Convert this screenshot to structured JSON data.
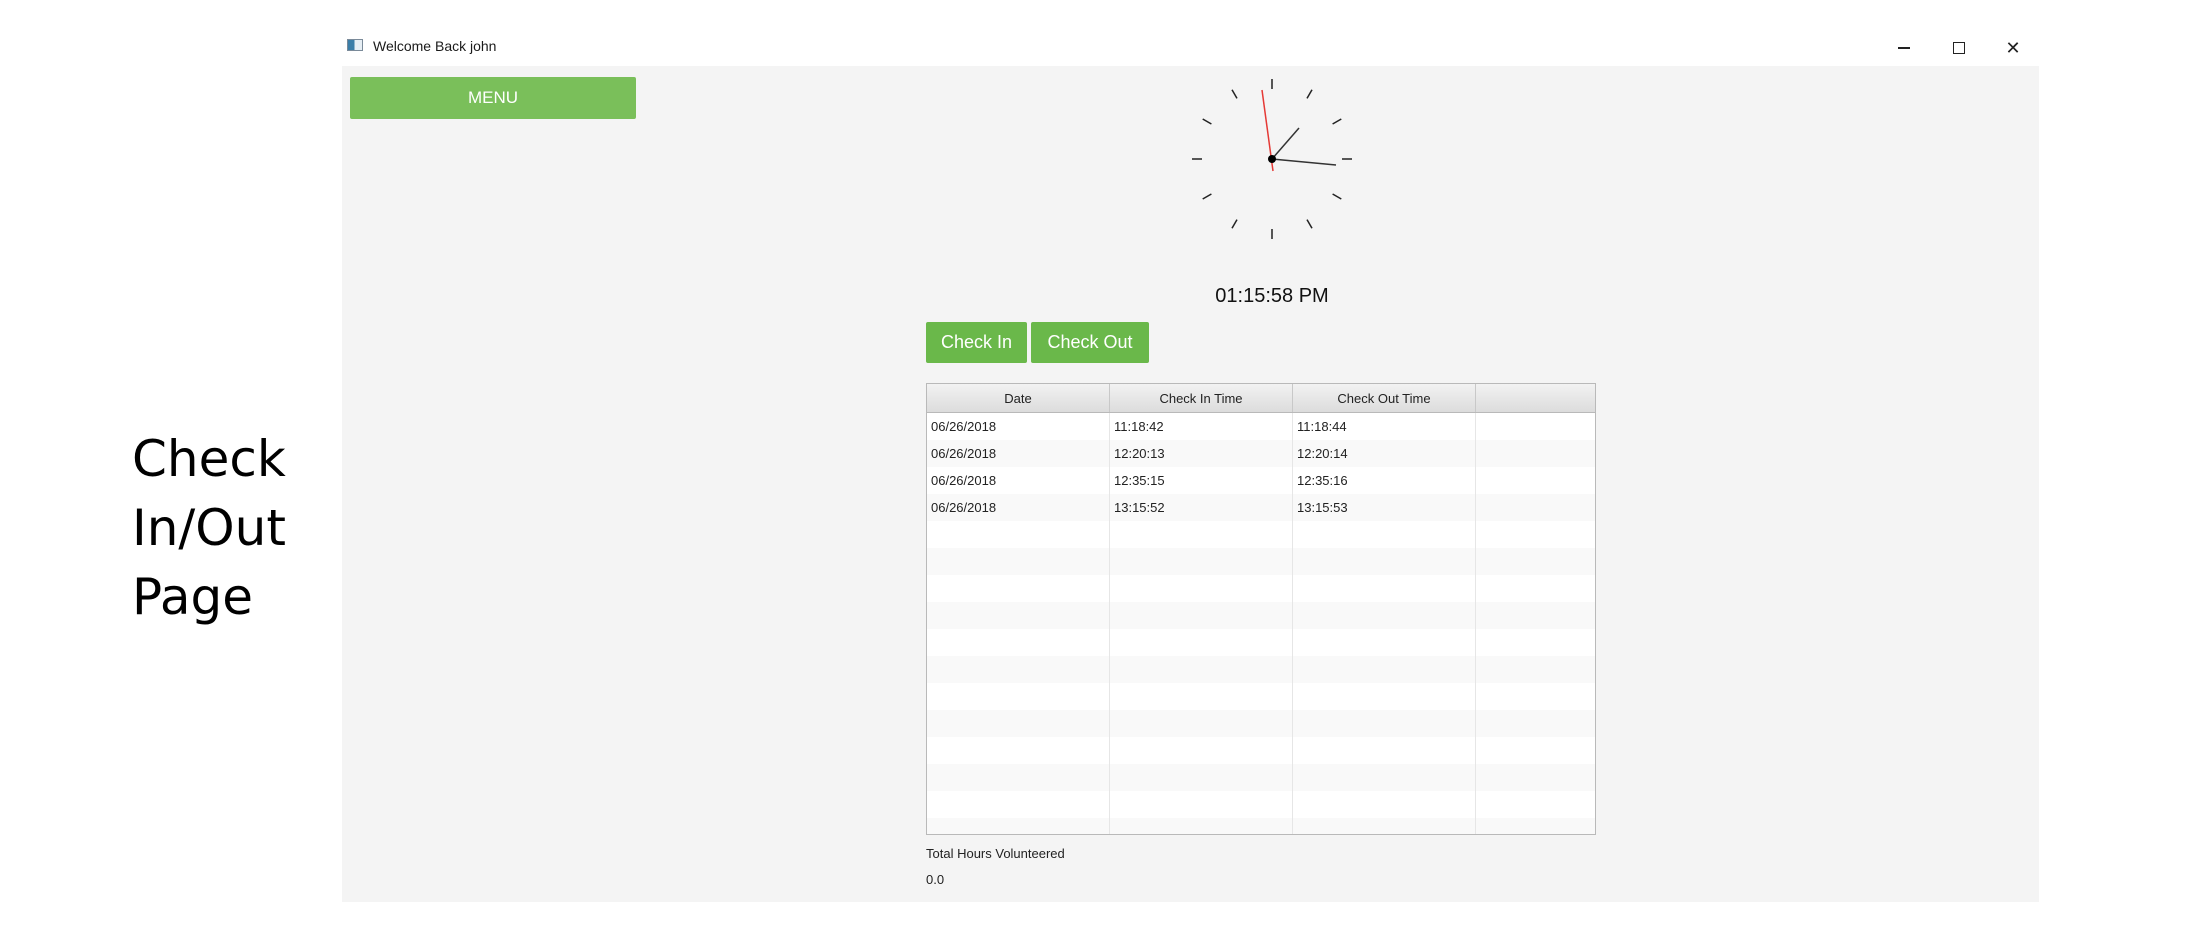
{
  "slide_label": [
    "Check",
    "In/Out",
    "Page"
  ],
  "window": {
    "title": "Welcome Back john"
  },
  "menu": {
    "label": "MENU",
    "color": "#7abf5a"
  },
  "clock": {
    "time_text": "01:15:58 PM",
    "second_hand_color": "#e53935"
  },
  "actions": {
    "check_in_label": "Check In",
    "check_out_label": "Check Out",
    "button_color": "#6ab84a"
  },
  "table": {
    "columns": [
      "Date",
      "Check In Time",
      "Check Out Time",
      ""
    ],
    "rows": [
      [
        "06/26/2018",
        "11:18:42",
        "11:18:44",
        ""
      ],
      [
        "06/26/2018",
        "12:20:13",
        "12:20:14",
        ""
      ],
      [
        "06/26/2018",
        "12:35:15",
        "12:35:16",
        ""
      ],
      [
        "06/26/2018",
        "13:15:52",
        "13:15:53",
        ""
      ]
    ]
  },
  "totals": {
    "label": "Total Hours Volunteered",
    "value": "0.0"
  }
}
